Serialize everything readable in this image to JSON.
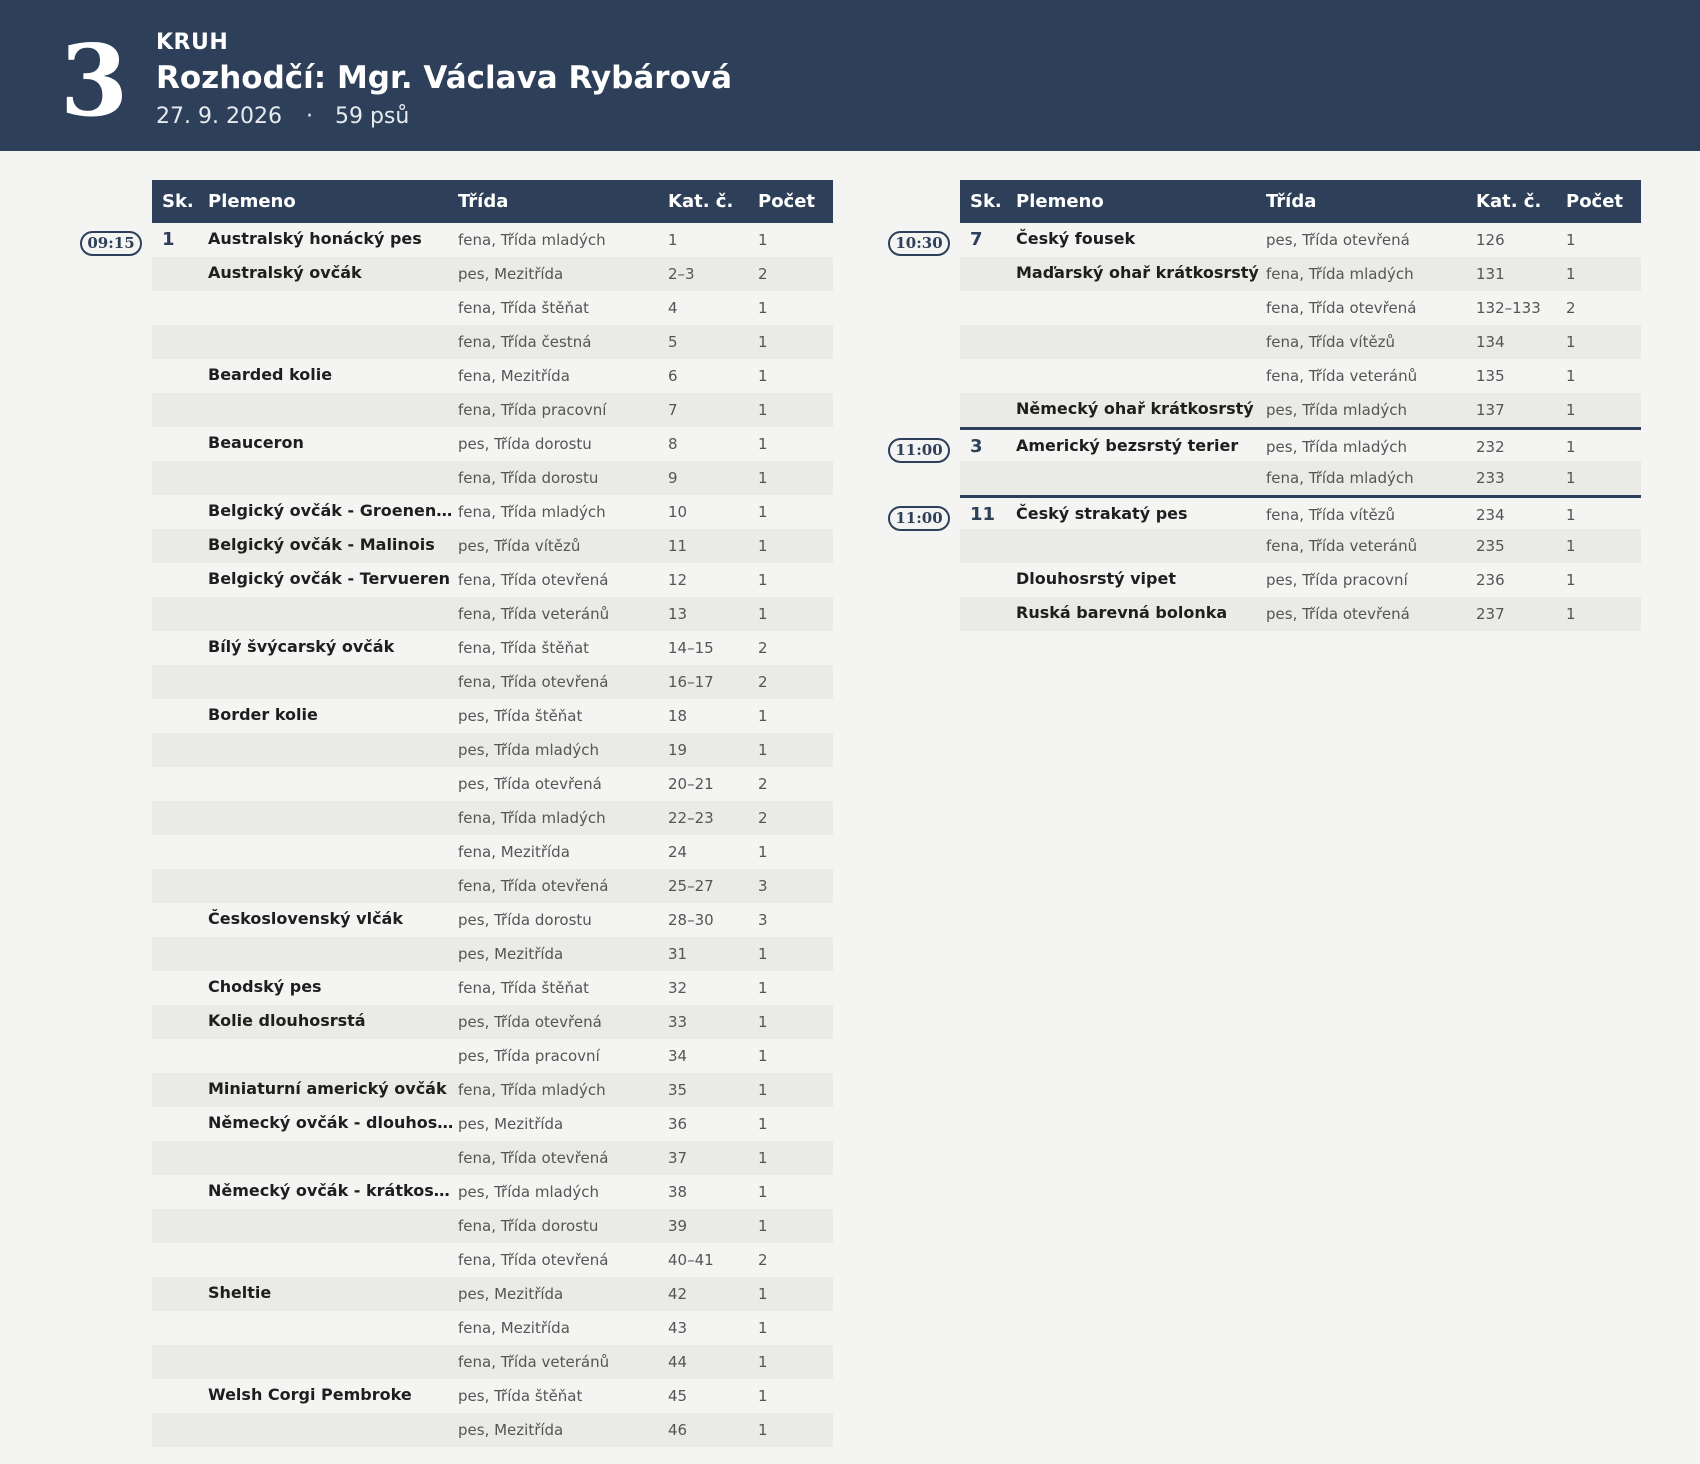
{
  "header": {
    "ring_number": "3",
    "ring_label": "KRUH",
    "judge": "Rozhodčí: Mgr. Václava Rybárová",
    "date": "27. 9. 2026",
    "separator": "·",
    "dog_count": "59 psů"
  },
  "columns": {
    "sk": "Sk.",
    "breed": "Plemeno",
    "class": "Třída",
    "cat": "Kat. č.",
    "count": "Počet"
  },
  "left_rows": [
    {
      "time": "09:15",
      "sk": "1",
      "breed": "Australský honácký pes",
      "class": "fena, Třída mladých",
      "cat": "1",
      "count": "1"
    },
    {
      "time": "",
      "sk": "",
      "breed": "Australský ovčák",
      "class": "pes, Mezitřída",
      "cat": "2–3",
      "count": "2"
    },
    {
      "time": "",
      "sk": "",
      "breed": "",
      "class": "fena, Třída štěňat",
      "cat": "4",
      "count": "1"
    },
    {
      "time": "",
      "sk": "",
      "breed": "",
      "class": "fena, Třída čestná",
      "cat": "5",
      "count": "1"
    },
    {
      "time": "",
      "sk": "",
      "breed": "Bearded kolie",
      "class": "fena, Mezitřída",
      "cat": "6",
      "count": "1"
    },
    {
      "time": "",
      "sk": "",
      "breed": "",
      "class": "fena, Třída pracovní",
      "cat": "7",
      "count": "1"
    },
    {
      "time": "",
      "sk": "",
      "breed": "Beauceron",
      "class": "pes, Třída dorostu",
      "cat": "8",
      "count": "1"
    },
    {
      "time": "",
      "sk": "",
      "breed": "",
      "class": "fena, Třída dorostu",
      "cat": "9",
      "count": "1"
    },
    {
      "time": "",
      "sk": "",
      "breed": "Belgický ovčák - Groenendael",
      "class": "fena, Třída mladých",
      "cat": "10",
      "count": "1"
    },
    {
      "time": "",
      "sk": "",
      "breed": "Belgický ovčák - Malinois",
      "class": "pes, Třída vítězů",
      "cat": "11",
      "count": "1"
    },
    {
      "time": "",
      "sk": "",
      "breed": "Belgický ovčák - Tervueren",
      "class": "fena, Třída otevřená",
      "cat": "12",
      "count": "1"
    },
    {
      "time": "",
      "sk": "",
      "breed": "",
      "class": "fena, Třída veteránů",
      "cat": "13",
      "count": "1"
    },
    {
      "time": "",
      "sk": "",
      "breed": "Bílý švýcarský ovčák",
      "class": "fena, Třída štěňat",
      "cat": "14–15",
      "count": "2"
    },
    {
      "time": "",
      "sk": "",
      "breed": "",
      "class": "fena, Třída otevřená",
      "cat": "16–17",
      "count": "2"
    },
    {
      "time": "",
      "sk": "",
      "breed": "Border kolie",
      "class": "pes, Třída štěňat",
      "cat": "18",
      "count": "1"
    },
    {
      "time": "",
      "sk": "",
      "breed": "",
      "class": "pes, Třída mladých",
      "cat": "19",
      "count": "1"
    },
    {
      "time": "",
      "sk": "",
      "breed": "",
      "class": "pes, Třída otevřená",
      "cat": "20–21",
      "count": "2"
    },
    {
      "time": "",
      "sk": "",
      "breed": "",
      "class": "fena, Třída mladých",
      "cat": "22–23",
      "count": "2"
    },
    {
      "time": "",
      "sk": "",
      "breed": "",
      "class": "fena, Mezitřída",
      "cat": "24",
      "count": "1"
    },
    {
      "time": "",
      "sk": "",
      "breed": "",
      "class": "fena, Třída otevřená",
      "cat": "25–27",
      "count": "3"
    },
    {
      "time": "",
      "sk": "",
      "breed": "Československý vlčák",
      "class": "pes, Třída dorostu",
      "cat": "28–30",
      "count": "3"
    },
    {
      "time": "",
      "sk": "",
      "breed": "",
      "class": "pes, Mezitřída",
      "cat": "31",
      "count": "1"
    },
    {
      "time": "",
      "sk": "",
      "breed": "Chodský pes",
      "class": "fena, Třída štěňat",
      "cat": "32",
      "count": "1"
    },
    {
      "time": "",
      "sk": "",
      "breed": "Kolie dlouhosrstá",
      "class": "pes, Třída otevřená",
      "cat": "33",
      "count": "1"
    },
    {
      "time": "",
      "sk": "",
      "breed": "",
      "class": "pes, Třída pracovní",
      "cat": "34",
      "count": "1"
    },
    {
      "time": "",
      "sk": "",
      "breed": "Miniaturní americký ovčák",
      "class": "fena, Třída mladých",
      "cat": "35",
      "count": "1"
    },
    {
      "time": "",
      "sk": "",
      "breed": "Německý ovčák - dlouhosrstý",
      "class": "pes, Mezitřída",
      "cat": "36",
      "count": "1"
    },
    {
      "time": "",
      "sk": "",
      "breed": "",
      "class": "fena, Třída otevřená",
      "cat": "37",
      "count": "1"
    },
    {
      "time": "",
      "sk": "",
      "breed": "Německý ovčák - krátkosrstý",
      "class": "pes, Třída mladých",
      "cat": "38",
      "count": "1"
    },
    {
      "time": "",
      "sk": "",
      "breed": "",
      "class": "fena, Třída dorostu",
      "cat": "39",
      "count": "1"
    },
    {
      "time": "",
      "sk": "",
      "breed": "",
      "class": "fena, Třída otevřená",
      "cat": "40–41",
      "count": "2"
    },
    {
      "time": "",
      "sk": "",
      "breed": "Sheltie",
      "class": "pes, Mezitřída",
      "cat": "42",
      "count": "1"
    },
    {
      "time": "",
      "sk": "",
      "breed": "",
      "class": "fena, Mezitřída",
      "cat": "43",
      "count": "1"
    },
    {
      "time": "",
      "sk": "",
      "breed": "",
      "class": "fena, Třída veteránů",
      "cat": "44",
      "count": "1"
    },
    {
      "time": "",
      "sk": "",
      "breed": "Welsh Corgi Pembroke",
      "class": "pes, Třída štěňat",
      "cat": "45",
      "count": "1"
    },
    {
      "time": "",
      "sk": "",
      "breed": "",
      "class": "pes, Mezitřída",
      "cat": "46",
      "count": "1"
    }
  ],
  "right_rows": [
    {
      "time": "10:30",
      "sk": "7",
      "breed": "Český fousek",
      "class": "pes, Třída otevřená",
      "cat": "126",
      "count": "1",
      "group_start": false
    },
    {
      "time": "",
      "sk": "",
      "breed": "Maďarský ohař krátkosrstý",
      "class": "fena, Třída mladých",
      "cat": "131",
      "count": "1",
      "group_start": false
    },
    {
      "time": "",
      "sk": "",
      "breed": "",
      "class": "fena, Třída otevřená",
      "cat": "132–133",
      "count": "2",
      "group_start": false
    },
    {
      "time": "",
      "sk": "",
      "breed": "",
      "class": "fena, Třída vítězů",
      "cat": "134",
      "count": "1",
      "group_start": false
    },
    {
      "time": "",
      "sk": "",
      "breed": "",
      "class": "fena, Třída veteránů",
      "cat": "135",
      "count": "1",
      "group_start": false
    },
    {
      "time": "",
      "sk": "",
      "breed": "Německý ohař krátkosrstý",
      "class": "pes, Třída mladých",
      "cat": "137",
      "count": "1",
      "group_start": false
    },
    {
      "time": "11:00",
      "sk": "3",
      "breed": "Americký bezsrstý terier",
      "class": "pes, Třída mladých",
      "cat": "232",
      "count": "1",
      "group_start": true
    },
    {
      "time": "",
      "sk": "",
      "breed": "",
      "class": "fena, Třída mladých",
      "cat": "233",
      "count": "1",
      "group_start": false
    },
    {
      "time": "11:00",
      "sk": "11",
      "breed": "Český strakatý pes",
      "class": "fena, Třída vítězů",
      "cat": "234",
      "count": "1",
      "group_start": true
    },
    {
      "time": "",
      "sk": "",
      "breed": "",
      "class": "fena, Třída veteránů",
      "cat": "235",
      "count": "1",
      "group_start": false
    },
    {
      "time": "",
      "sk": "",
      "breed": "Dlouhosrstý vipet",
      "class": "pes, Třída pracovní",
      "cat": "236",
      "count": "1",
      "group_start": false
    },
    {
      "time": "",
      "sk": "",
      "breed": "Ruská barevná bolonka",
      "class": "pes, Třída otevřená",
      "cat": "237",
      "count": "1",
      "group_start": false
    }
  ]
}
